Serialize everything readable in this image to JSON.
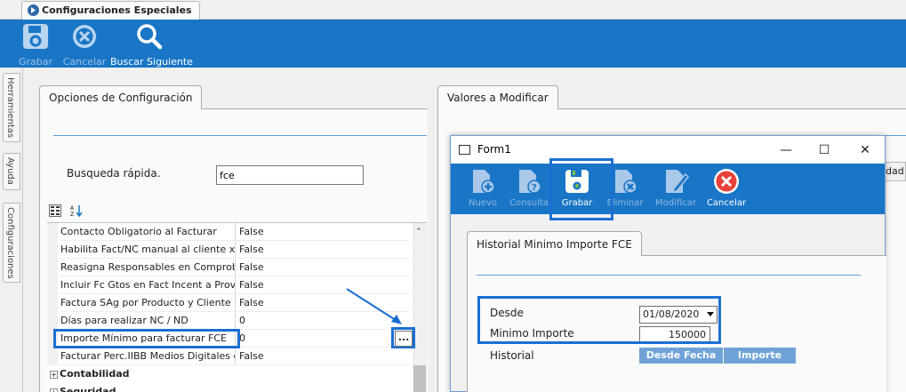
{
  "document_tab": {
    "title": "Configuraciones Especiales"
  },
  "main_toolbar": {
    "buttons": [
      {
        "label": "Grabar",
        "icon": "save-icon",
        "enabled": false
      },
      {
        "label": "Cancelar",
        "icon": "cancel-icon",
        "enabled": false
      },
      {
        "label": "Buscar Siguiente",
        "icon": "search-icon",
        "enabled": true
      }
    ]
  },
  "side_tabs": [
    "Herramientas",
    "Ayuda",
    "Configuraciones"
  ],
  "left_panel": {
    "tab_label": "Opciones de Configuración",
    "search_label": "Busqueda rápida.",
    "search_value": "fce",
    "properties": [
      {
        "name": "Contacto Obligatorio al Facturar",
        "value": "False"
      },
      {
        "name": "Habilita Fact/NC manual al cliente x Usu",
        "value": "False"
      },
      {
        "name": "Reasigna Responsables en Comprobante",
        "value": "False"
      },
      {
        "name": "Incluir Fc Gtos en Fact Incent a Prov.",
        "value": "False"
      },
      {
        "name": "Factura SAg por Producto y Cliente Fac",
        "value": "False"
      },
      {
        "name": "Días para realizar NC / ND",
        "value": "0"
      },
      {
        "name": "Importe Mínimo para facturar FCE",
        "value": "0"
      },
      {
        "name": "Facturar Perc.IIBB Medios Digitales del",
        "value": "False"
      }
    ],
    "categories": [
      "Contabilidad",
      "Seguridad"
    ],
    "ellipsis_label": "..."
  },
  "right_panel": {
    "tab_label": "Valores a Modificar",
    "partial_header": "dad"
  },
  "dialog": {
    "title": "Form1",
    "controls": {
      "minimize": "—",
      "maximize": "☐",
      "close": "✕"
    },
    "toolbar": [
      {
        "label": "Nuevo",
        "icon": "new-document-icon",
        "enabled": false
      },
      {
        "label": "Consulta",
        "icon": "query-document-icon",
        "enabled": false
      },
      {
        "label": "Grabar",
        "icon": "save-icon",
        "enabled": true
      },
      {
        "label": "Eliminar",
        "icon": "delete-document-icon",
        "enabled": false
      },
      {
        "label": "Modificar",
        "icon": "edit-document-icon",
        "enabled": false
      },
      {
        "label": "Cancelar",
        "icon": "cancel-icon",
        "enabled": true
      }
    ],
    "tab_label": "Historial Minimo Importe FCE",
    "desde_label": "Desde",
    "desde_value": "01/08/2020",
    "minimo_label": "Minimo Importe",
    "minimo_value": "150000",
    "historial_label": "Historial",
    "historial_columns": [
      "Desde Fecha",
      "Importe"
    ]
  },
  "colors": {
    "toolbar_blue": "#1976c6",
    "highlight_blue": "#1b6fd1",
    "grid_header_blue": "#6fa3d8",
    "cancel_red": "#e8413a"
  }
}
